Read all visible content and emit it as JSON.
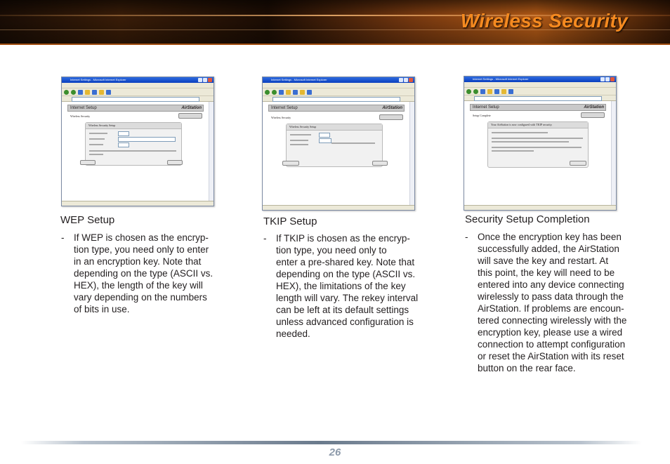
{
  "header": {
    "title": "Wireless Security"
  },
  "screenshots": [
    {
      "window_title": "Internet Settings - Microsoft Internet Explorer",
      "section_bar": "Internet Setup",
      "brand": "AirStation",
      "subtitle": "Wireless Security",
      "panel_title": "Wireless Security Setup"
    },
    {
      "window_title": "Internet Settings - Microsoft Internet Explorer",
      "section_bar": "Internet Setup",
      "brand": "AirStation",
      "subtitle": "Wireless Security",
      "panel_title": "Wireless Security Setup"
    },
    {
      "window_title": "Internet Settings - Microsoft Internet Explorer",
      "section_bar": "Internet Setup",
      "brand": "AirStation",
      "subtitle": "Setup Complete",
      "panel_title": "Your AirStation is now configured with TKIP security."
    }
  ],
  "sections": [
    {
      "caption": "WEP Setup",
      "bullet": "-",
      "lines": [
        "If WEP is chosen as the encryp-",
        "tion type, you need only to enter",
        "in an encryption key. Note that",
        "depending on the type (ASCII vs.",
        "HEX), the length of the key will",
        "vary depending on the numbers",
        "of bits in use."
      ]
    },
    {
      "caption": "TKIP Setup",
      "bullet": "-",
      "lines": [
        "If TKIP is chosen as the encryp-",
        "tion type, you need only to",
        "enter a pre-shared key. Note that",
        "depending on the type (ASCII vs.",
        "HEX), the limitations of the key",
        "length will vary. The rekey interval",
        "can be left at its default settings",
        "unless advanced configuration is",
        "needed."
      ]
    },
    {
      "caption": "Security Setup Completion",
      "bullet": "-",
      "lines": [
        "Once the encryption key has been",
        "successfully added, the AirStation",
        "will save the key and restart. At",
        "this point, the key will need to be",
        "entered into any device connecting",
        "wirelessly to pass data through the",
        "AirStation. If problems are encoun-",
        "tered connecting wirelessly with the",
        "encryption key, please use a wired",
        "connection to attempt configuration",
        "or reset the AirStation with its reset",
        "button on the rear face."
      ]
    }
  ],
  "footer": {
    "page_number": "26"
  },
  "colors": {
    "title_orange": "#f58a20",
    "page_number": "#8d9aaa"
  }
}
